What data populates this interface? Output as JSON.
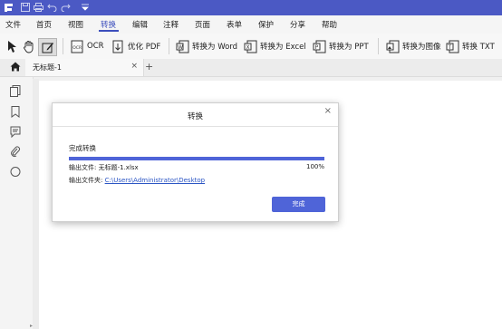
{
  "titlebar": {
    "icons": [
      "app-logo-icon",
      "save-icon",
      "print-icon",
      "undo-icon",
      "redo-icon",
      "dropdown-icon"
    ]
  },
  "menu": {
    "items": [
      "文件",
      "首页",
      "视图",
      "转换",
      "编辑",
      "注释",
      "页面",
      "表单",
      "保护",
      "分享",
      "帮助"
    ],
    "active": "转换"
  },
  "toolbar": {
    "ocr": "OCR",
    "optimize": "优化 PDF",
    "to_word": "转换为 Word",
    "to_excel": "转换为 Excel",
    "to_ppt": "转换为 PPT",
    "to_image": "转换为图像",
    "to_txt": "转换 TXT"
  },
  "tab": {
    "label": "无标题-1",
    "close": "×",
    "add": "+"
  },
  "dialog": {
    "title": "转换",
    "close": "×",
    "status": "完成转换",
    "progress": 1.0,
    "percent": "100%",
    "output_file_label": "输出文件:",
    "output_file": "无标题-1.xlsx",
    "output_folder_label": "输出文件夹:",
    "output_folder": "C:\\Users\\Administrator\\Desktop",
    "done_button": "完成"
  },
  "colors": {
    "accent": "#4b59c4",
    "button": "#4f64d8",
    "link": "#2b55c4"
  }
}
